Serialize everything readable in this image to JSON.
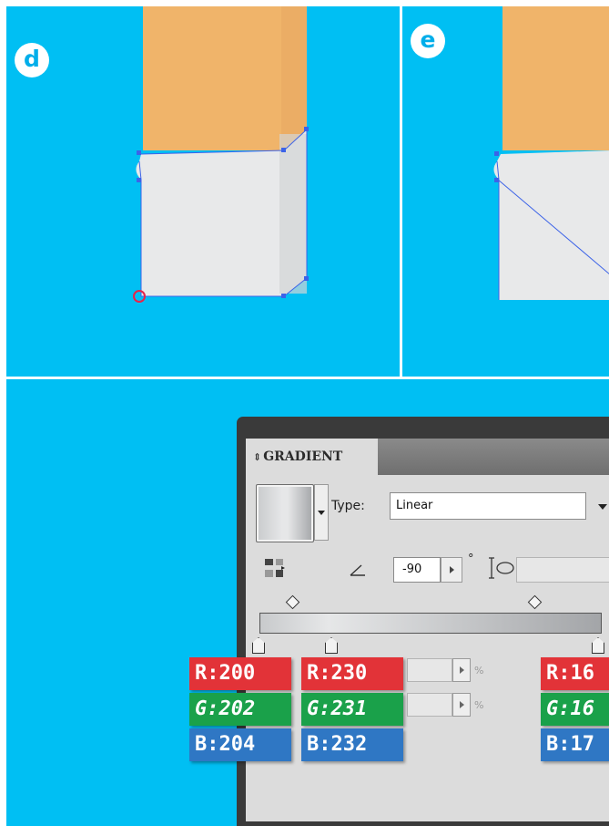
{
  "steps": {
    "d": "d",
    "e": "e"
  },
  "colors": {
    "background": "#00bff3",
    "shape_top": "#f0b46a",
    "shape_body": "#e8e9ea",
    "anchor": "#3c63e8",
    "selected_anchor": "#e8234a",
    "red_tag": "#e23338",
    "green_tag": "#1aa14a",
    "blue_tag": "#2f77c4"
  },
  "gradient_panel": {
    "title": "GRADIENT",
    "title_icon": "collapse-arrows-icon",
    "type_label": "Type:",
    "type_value": "Linear",
    "angle_value": "-90",
    "degree_symbol": "°",
    "percent_label": "%",
    "icons": [
      "reverse-gradient-icon",
      "angle-icon",
      "aspect-ratio-icon",
      "dropdown-arrow-icon"
    ]
  },
  "color_stops": [
    {
      "r": "R:200",
      "g": "G:202",
      "b": "B:204"
    },
    {
      "r": "R:230",
      "g": "G:231",
      "b": "B:232"
    },
    {
      "r": "R:16",
      "g": "G:16",
      "b": "B:17"
    }
  ]
}
